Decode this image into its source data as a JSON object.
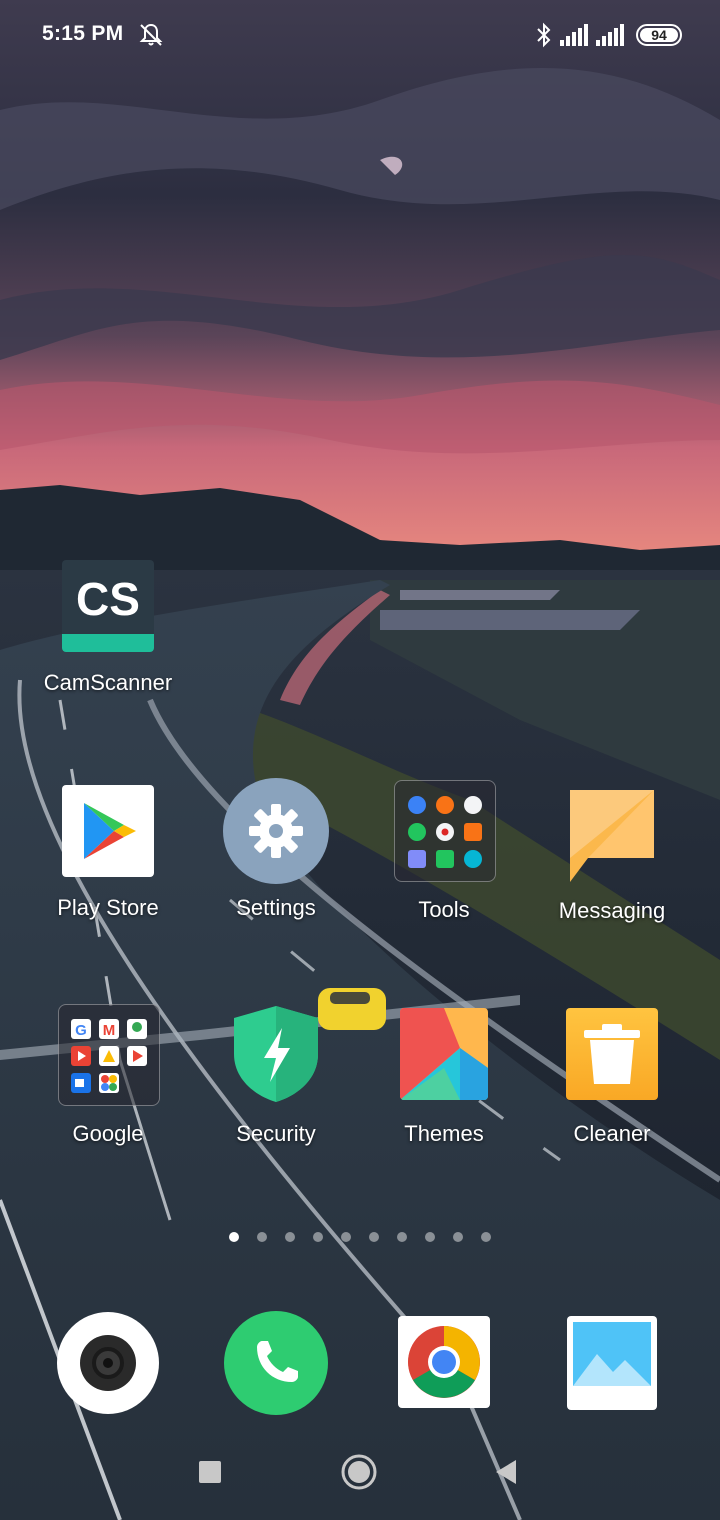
{
  "status_bar": {
    "time": "5:15 PM",
    "icons": [
      "mute-notifications-icon",
      "bluetooth-icon",
      "signal-icon",
      "signal-icon"
    ],
    "battery": "94"
  },
  "home": {
    "camscanner": {
      "label": "CamScanner",
      "icon_text": "CS"
    },
    "play_store": {
      "label": "Play Store"
    },
    "settings": {
      "label": "Settings"
    },
    "tools": {
      "label": "Tools"
    },
    "messaging": {
      "label": "Messaging"
    },
    "google": {
      "label": "Google"
    },
    "security": {
      "label": "Security"
    },
    "themes": {
      "label": "Themes"
    },
    "cleaner": {
      "label": "Cleaner"
    }
  },
  "page_indicator": {
    "count": 10,
    "active": 1
  },
  "dock": {
    "apps": [
      "camera-icon",
      "phone-icon",
      "chrome-icon",
      "gallery-icon"
    ]
  },
  "nav_bar": {
    "buttons": [
      "recents-button",
      "home-button",
      "back-button"
    ]
  },
  "colors": {
    "camscanner_bg": "#2b3a45",
    "camscanner_accent": "#1fbe9a",
    "settings_bg": "#8aa3bd",
    "messaging": "#fbb84c",
    "security": "#2ecc8f",
    "cleaner": "#f9a825",
    "phone": "#2ecc71"
  }
}
